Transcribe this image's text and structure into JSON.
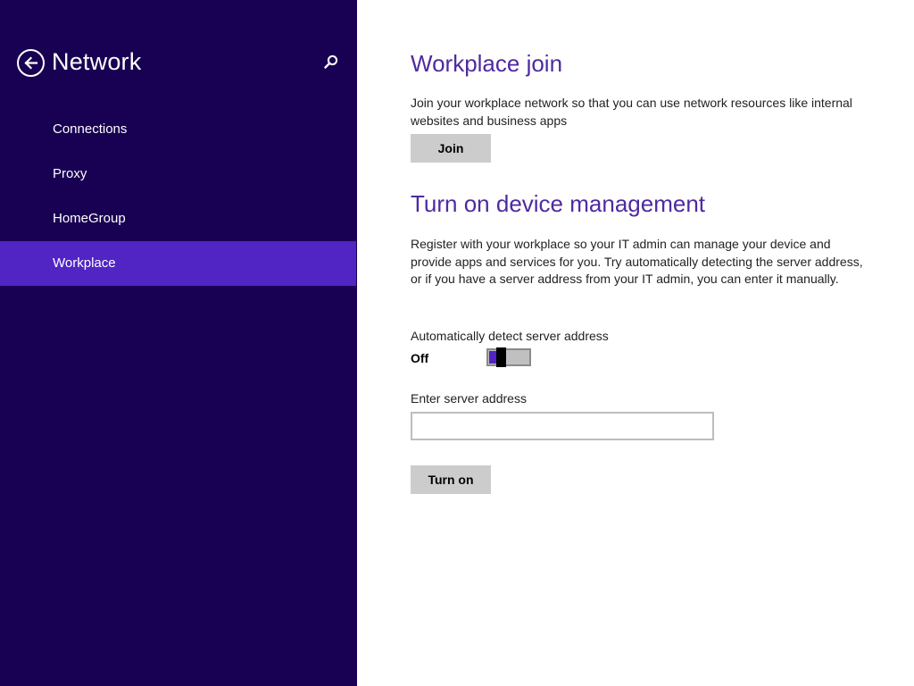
{
  "sidebar": {
    "title": "Network",
    "back_icon": "back-arrow-circle-icon",
    "search_icon": "search-icon",
    "items": [
      {
        "label": "Connections",
        "selected": false
      },
      {
        "label": "Proxy",
        "selected": false
      },
      {
        "label": "HomeGroup",
        "selected": false
      },
      {
        "label": "Workplace",
        "selected": true
      }
    ]
  },
  "main": {
    "workplace_join": {
      "heading": "Workplace join",
      "description": "Join your workplace network so that you can use network resources like internal websites and business apps",
      "button_label": "Join"
    },
    "device_management": {
      "heading": "Turn on device management",
      "description": "Register with your workplace so your IT admin can manage your device and provide apps and services for you. Try automatically detecting the server address, or if you have a server address from your IT admin, you can enter it manually.",
      "auto_detect_label": "Automatically detect server address",
      "auto_detect_state": "Off",
      "auto_detect_on": false,
      "server_address_label": "Enter server address",
      "server_address_value": "",
      "button_label": "Turn on"
    }
  },
  "colors": {
    "sidebar_bg": "#180052",
    "selected_item_bg": "#5124c4",
    "heading": "#4f2aa0",
    "button_bg": "#cccccc"
  }
}
